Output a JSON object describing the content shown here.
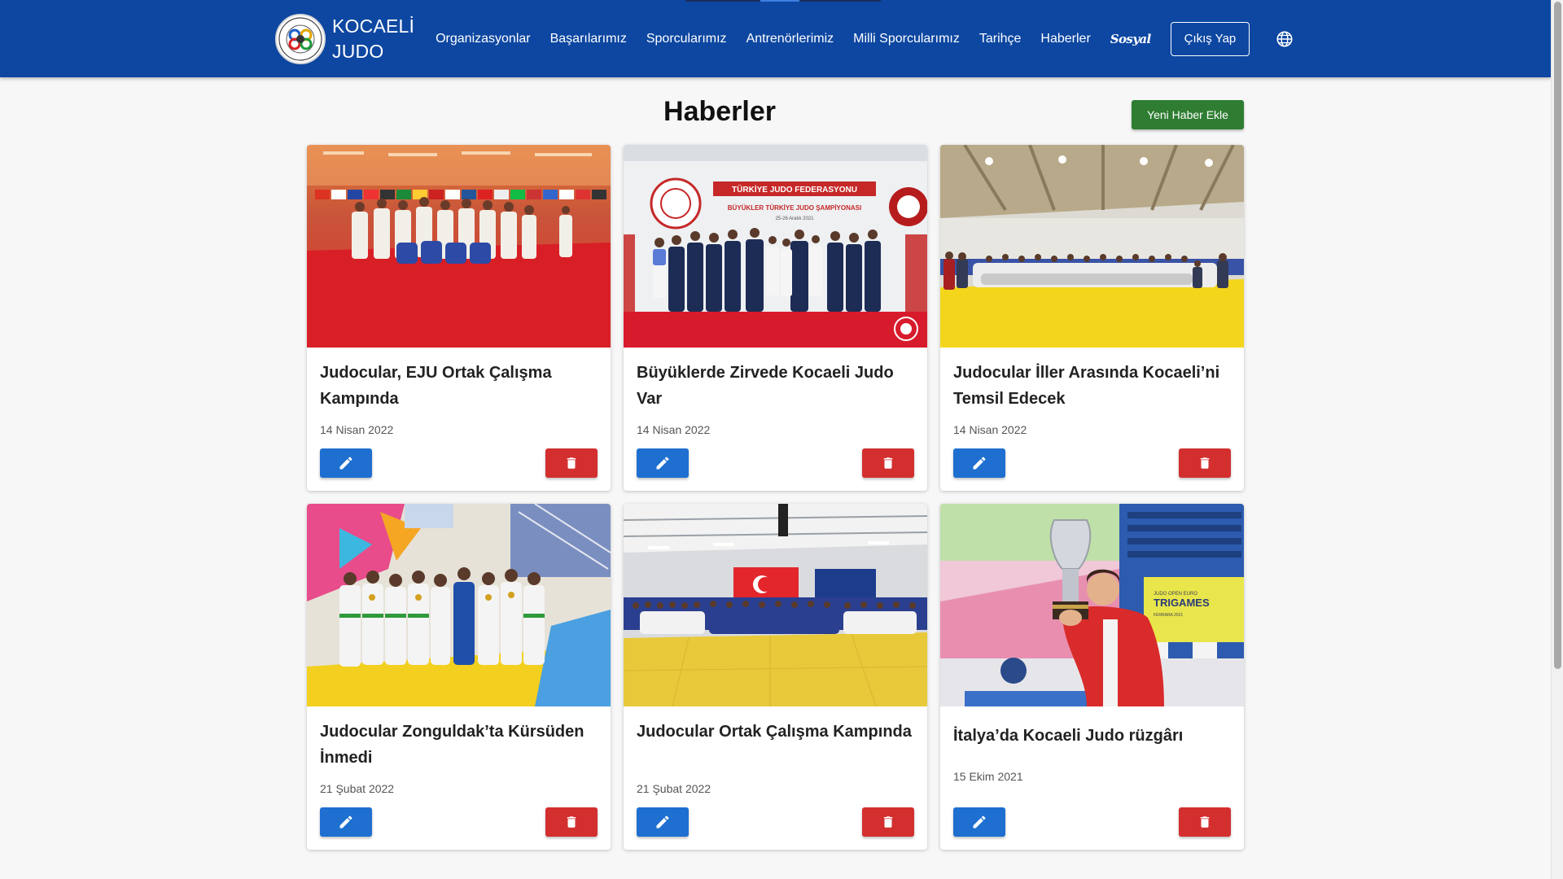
{
  "nav": {
    "brand_line1": "KOCAELİ",
    "brand_line2": "JUDO",
    "links": [
      {
        "label": "Organizasyonlar"
      },
      {
        "label": "Başarılarımız"
      },
      {
        "label": "Sporcularımız"
      },
      {
        "label": "Antrenörlerimiz"
      },
      {
        "label": "Milli Sporcularımız"
      },
      {
        "label": "Tarihçe"
      },
      {
        "label": "Haberler"
      }
    ],
    "social_label": "Sosyal",
    "logout_label": "Çıkış Yap",
    "color": "#0d47a1"
  },
  "page": {
    "title": "Haberler",
    "add_label": "Yeni Haber Ekle",
    "add_color": "#2e7d32"
  },
  "news": [
    {
      "title": "Judocular, EJU Ortak Çalışma Kampında",
      "date": "14 Nisan 2022",
      "photo": "red-mat-team-photo"
    },
    {
      "title": "Büyüklerde Zirvede Kocaeli Judo Var",
      "date": "14 Nisan 2022",
      "photo": "federation-podium-photo"
    },
    {
      "title": "Judocular İller Arasında Kocaeli’ni Temsil Edecek",
      "date": "14 Nisan 2022",
      "photo": "yellow-mat-group-photo"
    },
    {
      "title": "Judocular Zonguldak’ta Kürsüden İnmedi",
      "date": "21 Şubat 2022",
      "photo": "kids-medals-photo"
    },
    {
      "title": "Judocular Ortak Çalışma Kampında",
      "date": "21 Şubat 2022",
      "photo": "large-camp-group-photo"
    },
    {
      "title": "İtalya’da Kocaeli Judo rüzgârı",
      "date": "15 Ekim 2021",
      "photo": "trophy-athlete-photo"
    }
  ],
  "photo_texts": {
    "federation_banner_1": "TÜRKİYE JUDO FEDERASYONU",
    "federation_banner_2": "BÜYÜKLER TÜRKİYE JUDO ŞAMPİYONASI",
    "federation_banner_3": "25-26 Aralık 2021",
    "trigames_1": "JUDO OPEN EURO",
    "trigames_2": "TRIGAMES",
    "trigames_3": "FERRARA 2021"
  },
  "colors": {
    "edit": "#1e6fd0",
    "delete": "#d32f2f"
  }
}
